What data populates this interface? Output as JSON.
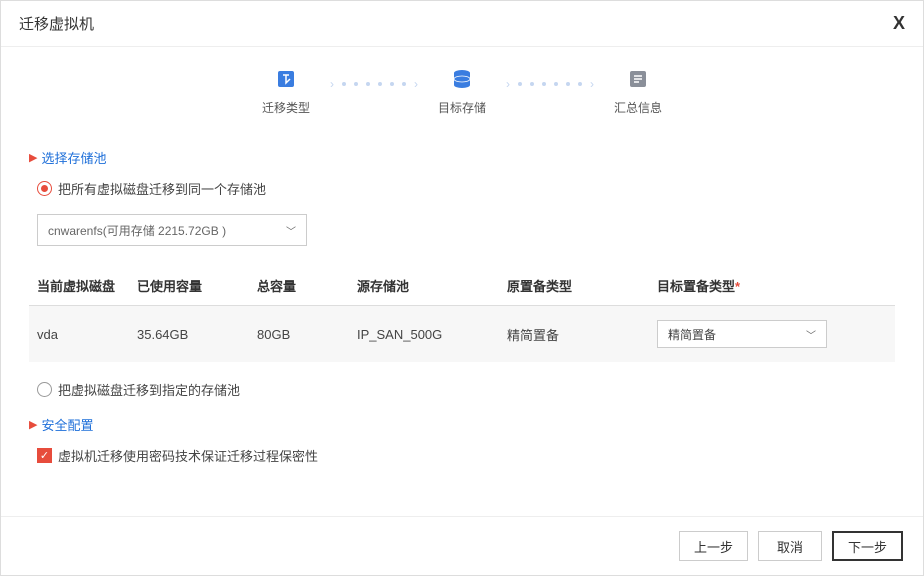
{
  "dialog": {
    "title": "迁移虚拟机",
    "close": "X"
  },
  "steps": {
    "step1": "迁移类型",
    "step2": "目标存储",
    "step3": "汇总信息"
  },
  "section1": {
    "title": "选择存储池",
    "option1": "把所有虚拟磁盘迁移到同一个存储池",
    "dropdown": "cnwarenfs(可用存储 2215.72GB )",
    "option2": "把虚拟磁盘迁移到指定的存储池"
  },
  "table": {
    "headers": {
      "disk": "当前虚拟磁盘",
      "used": "已使用容量",
      "total": "总容量",
      "source": "源存储池",
      "origType": "原置备类型",
      "targetType": "目标置备类型"
    },
    "row": {
      "disk": "vda",
      "used": "35.64GB",
      "total": "80GB",
      "source": "IP_SAN_500G",
      "origType": "精简置备",
      "targetType": "精简置备"
    }
  },
  "section2": {
    "title": "安全配置",
    "checkbox": "虚拟机迁移使用密码技术保证迁移过程保密性"
  },
  "footer": {
    "prev": "上一步",
    "cancel": "取消",
    "next": "下一步"
  }
}
